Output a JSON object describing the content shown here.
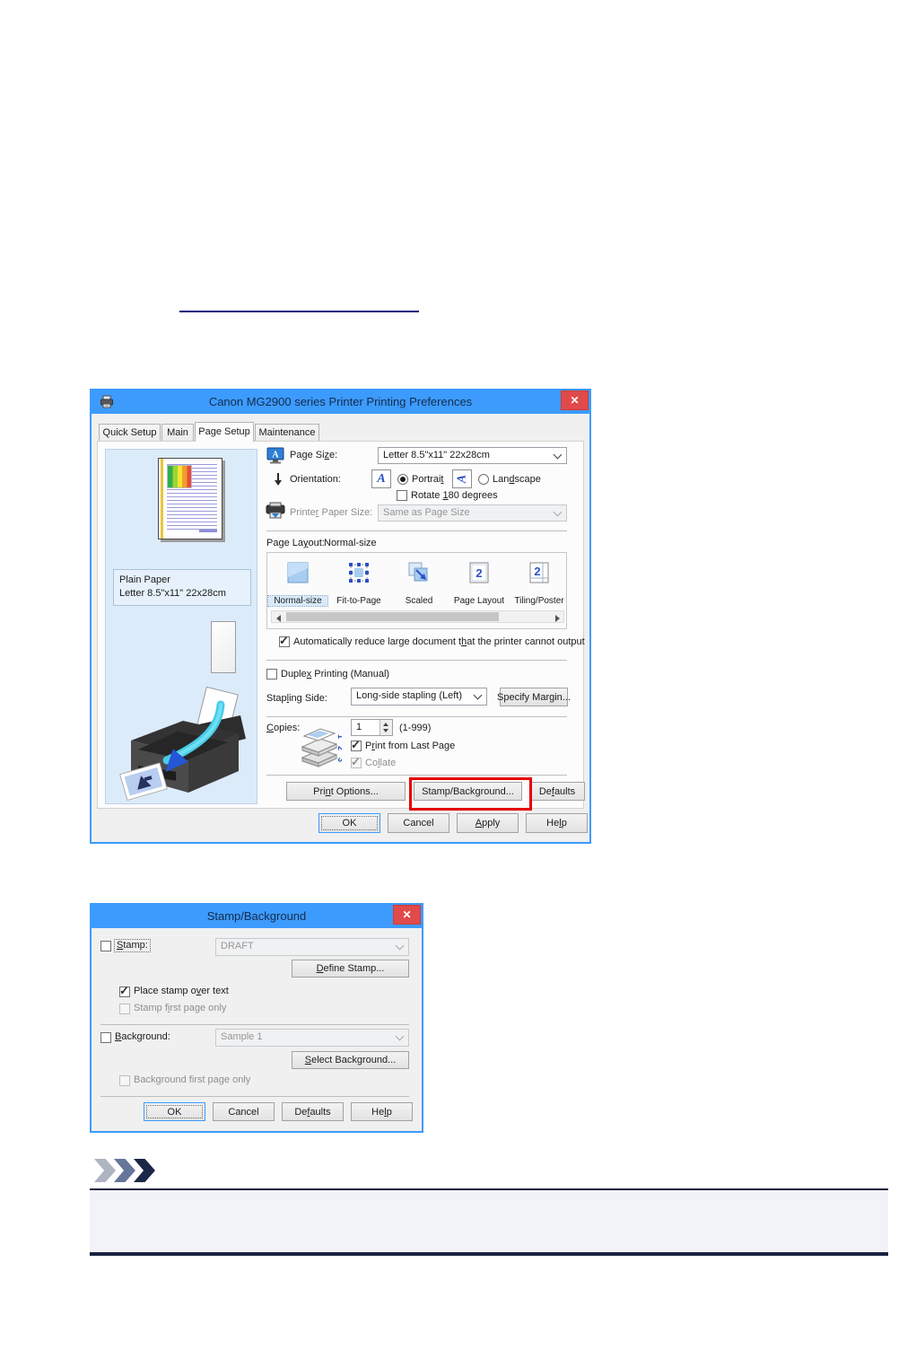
{
  "page": {
    "link_text": ""
  },
  "dlg1": {
    "title": "Canon MG2900 series Printer Printing Preferences",
    "close_glyph": "✕",
    "tabs": [
      "Quick Setup",
      "Main",
      "Page Setup",
      "Maintenance"
    ],
    "preview": {
      "media": "Plain Paper",
      "size": "Letter 8.5\"x11\" 22x28cm"
    },
    "page_size": {
      "label": "Page Si_ze:",
      "value": "Letter 8.5\"x11\" 22x28cm"
    },
    "orientation": {
      "label": "Orientation:",
      "portrait": "Portrai_t",
      "landscape": "Lan_dscape",
      "rotate": "Rotate _180 degrees"
    },
    "printer_paper_size": {
      "label": "Printe_r Paper Size:",
      "value": "Same as Page Size"
    },
    "page_layout": {
      "label": "Page La_yout:",
      "value": "Normal-size"
    },
    "layout_items": [
      "Normal-size",
      "Fit-to-Page",
      "Scaled",
      "Page Layout",
      "Tiling/Poster"
    ],
    "auto_reduce": "Automatically reduce large document t_hat the printer cannot output",
    "duplex": "Duple_x Printing (Manual)",
    "stapling": {
      "label": "Stap_ling Side:",
      "value": "Long-side stapling (Left)",
      "margin_btn": "Specify Mar_gin..."
    },
    "copies": {
      "label": "_Copies:",
      "value": "1",
      "range": "(1-999)",
      "last_page": "P_rint from Last Page",
      "collate": "Co_llate"
    },
    "buttons": {
      "print_options": "Pri_nt Options...",
      "stamp_bg": "Stamp/Back_ground...",
      "defaults": "De_faults",
      "ok": "OK",
      "cancel": "Cancel",
      "apply": "_Apply",
      "help": "He_lp"
    }
  },
  "dlg2": {
    "title": "Stamp/Background",
    "close_glyph": "✕",
    "stamp": {
      "label": "_Stamp:",
      "value": "DRAFT",
      "define_btn": "_Define Stamp...",
      "over_text": "Place stamp o_ver text",
      "first_page": "Stamp f_irst page only"
    },
    "background": {
      "label": "_Background:",
      "value": "Sample 1",
      "select_btn": "_Select Background...",
      "first_page": "Back_ground first page only"
    },
    "buttons": {
      "ok": "OK",
      "cancel": "Cancel",
      "defaults": "De_faults",
      "help": "He_lp"
    }
  },
  "colors": {
    "titlebar_blue": "#3d9bfd",
    "close_red": "#e14a4a",
    "highlight_red": "#e60000",
    "note_navy": "#18213f"
  }
}
